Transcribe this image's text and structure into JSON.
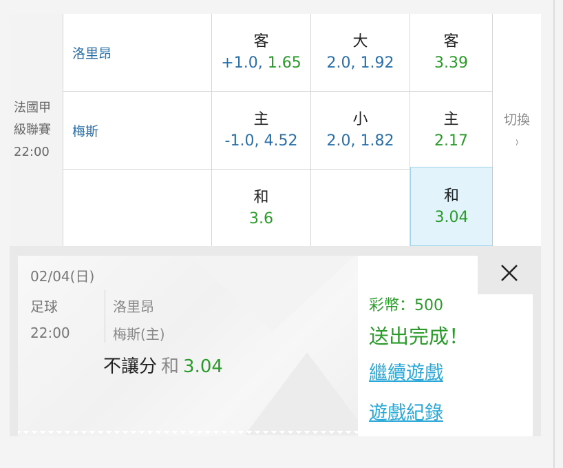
{
  "match": {
    "league_line1": "法國甲",
    "league_line2": "級聯賽",
    "time": "22:00",
    "away_team": "洛里昂",
    "home_team": "梅斯"
  },
  "odds": {
    "row1": {
      "handicap": {
        "label": "客",
        "line": "+1.0",
        "price": "1.65"
      },
      "total": {
        "label": "大",
        "value": "2.0, 1.92"
      },
      "moneyline": {
        "label": "客",
        "value": "3.39"
      }
    },
    "row2": {
      "handicap": {
        "label": "主",
        "line": "-1.0",
        "price": "4.52"
      },
      "total": {
        "label": "小",
        "value": "2.0, 1.82"
      },
      "moneyline": {
        "label": "主",
        "value": "2.17"
      }
    },
    "row3": {
      "handicap": {
        "label": "和",
        "value": "3.6"
      },
      "moneyline": {
        "label": "和",
        "value": "3.04"
      }
    }
  },
  "switch": {
    "label": "切換",
    "chevron": "›"
  },
  "slip": {
    "date": "02/04(日)",
    "sport": "足球",
    "time": "22:00",
    "team1": "洛里昂",
    "team2": "梅斯(主)",
    "bet_type": "不讓分",
    "outcome": "和",
    "odds": "3.04",
    "coins": "彩幣：500",
    "status": "送出完成！",
    "continue_link": "繼續遊戲",
    "history_link": "遊戲紀錄",
    "close_icon": "close-icon"
  },
  "colors": {
    "green": "#2a9b2a",
    "blue": "#2a6fa8",
    "link": "#2aa8d8",
    "selected_bg": "#e2f3fb"
  }
}
